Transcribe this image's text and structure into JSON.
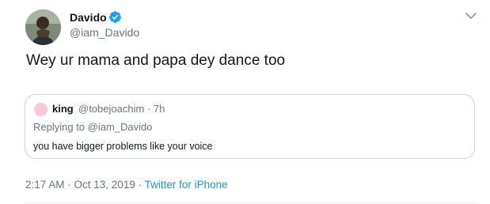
{
  "tweet": {
    "author": {
      "name": "Davido",
      "handle": "@iam_Davido",
      "verified": true
    },
    "text": "Wey ur mama and papa dey dance too",
    "quoted": {
      "name": "king",
      "handle_time": "@tobejoachim · 7h",
      "replying_prefix": "Replying to ",
      "replying_handle": "@iam_Davido",
      "text": "you have bigger problems like your voice"
    },
    "timestamp": "2:17 AM · Oct 13, 2019 · ",
    "source": "Twitter for iPhone"
  },
  "icons": {
    "verified": "verified-badge-icon",
    "menu": "chevron-down-icon"
  },
  "colors": {
    "accent": "#1da1f2",
    "link": "#1b95e0",
    "secondary_text": "#657786",
    "primary_text": "#14171a",
    "border": "#ccd6dd",
    "quote_avatar": "#f8c8dc"
  }
}
